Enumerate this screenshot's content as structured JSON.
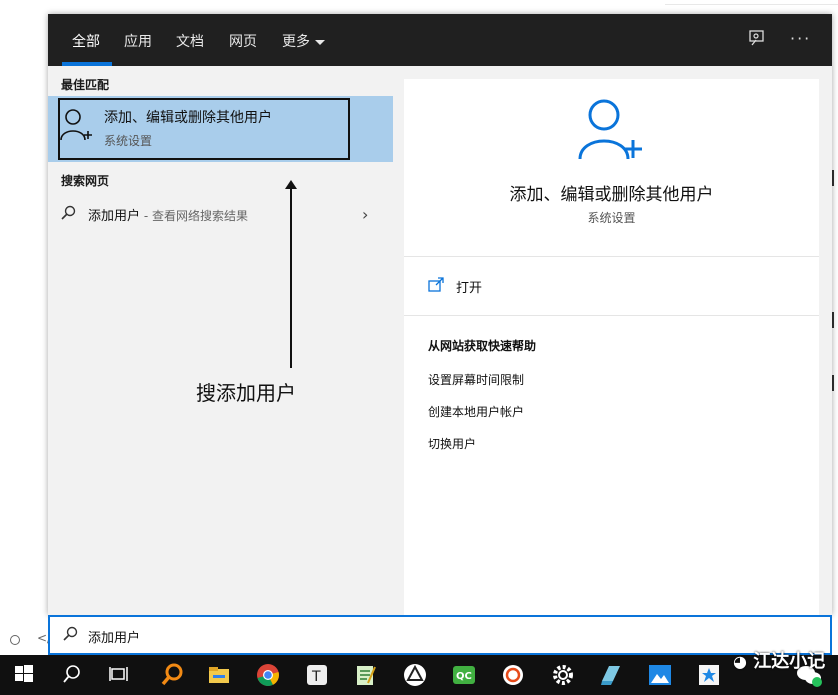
{
  "tabs": [
    "全部",
    "应用",
    "文档",
    "网页",
    "更多"
  ],
  "best_match": {
    "heading": "最佳匹配",
    "title": "添加、编辑或删除其他用户",
    "subtitle": "系统设置"
  },
  "web": {
    "heading": "搜索网页",
    "query": "添加用户",
    "hint": " - 查看网络搜索结果"
  },
  "annotation": "搜添加用户",
  "detail": {
    "title": "添加、编辑或删除其他用户",
    "subtitle": "系统设置",
    "open_label": "打开",
    "help_heading": "从网站获取快速帮助",
    "links": [
      "设置屏幕时间限制",
      "创建本地用户帐户",
      "切换用户"
    ]
  },
  "search": {
    "value": "添加用户"
  },
  "watermark": "江达小记",
  "colors": {
    "accent": "#0a74da",
    "selected": "#a9cdeb",
    "topbar": "#202020",
    "taskbar": "#101010"
  },
  "taskbar_icons": [
    "windows-start",
    "search",
    "task-view",
    "search-tool",
    "file-explorer",
    "chrome",
    "typora",
    "notepad",
    "recycle-app",
    "qc-app",
    "record-app",
    "settings",
    "paint-app",
    "photos-app",
    "star-app",
    "wechat"
  ]
}
